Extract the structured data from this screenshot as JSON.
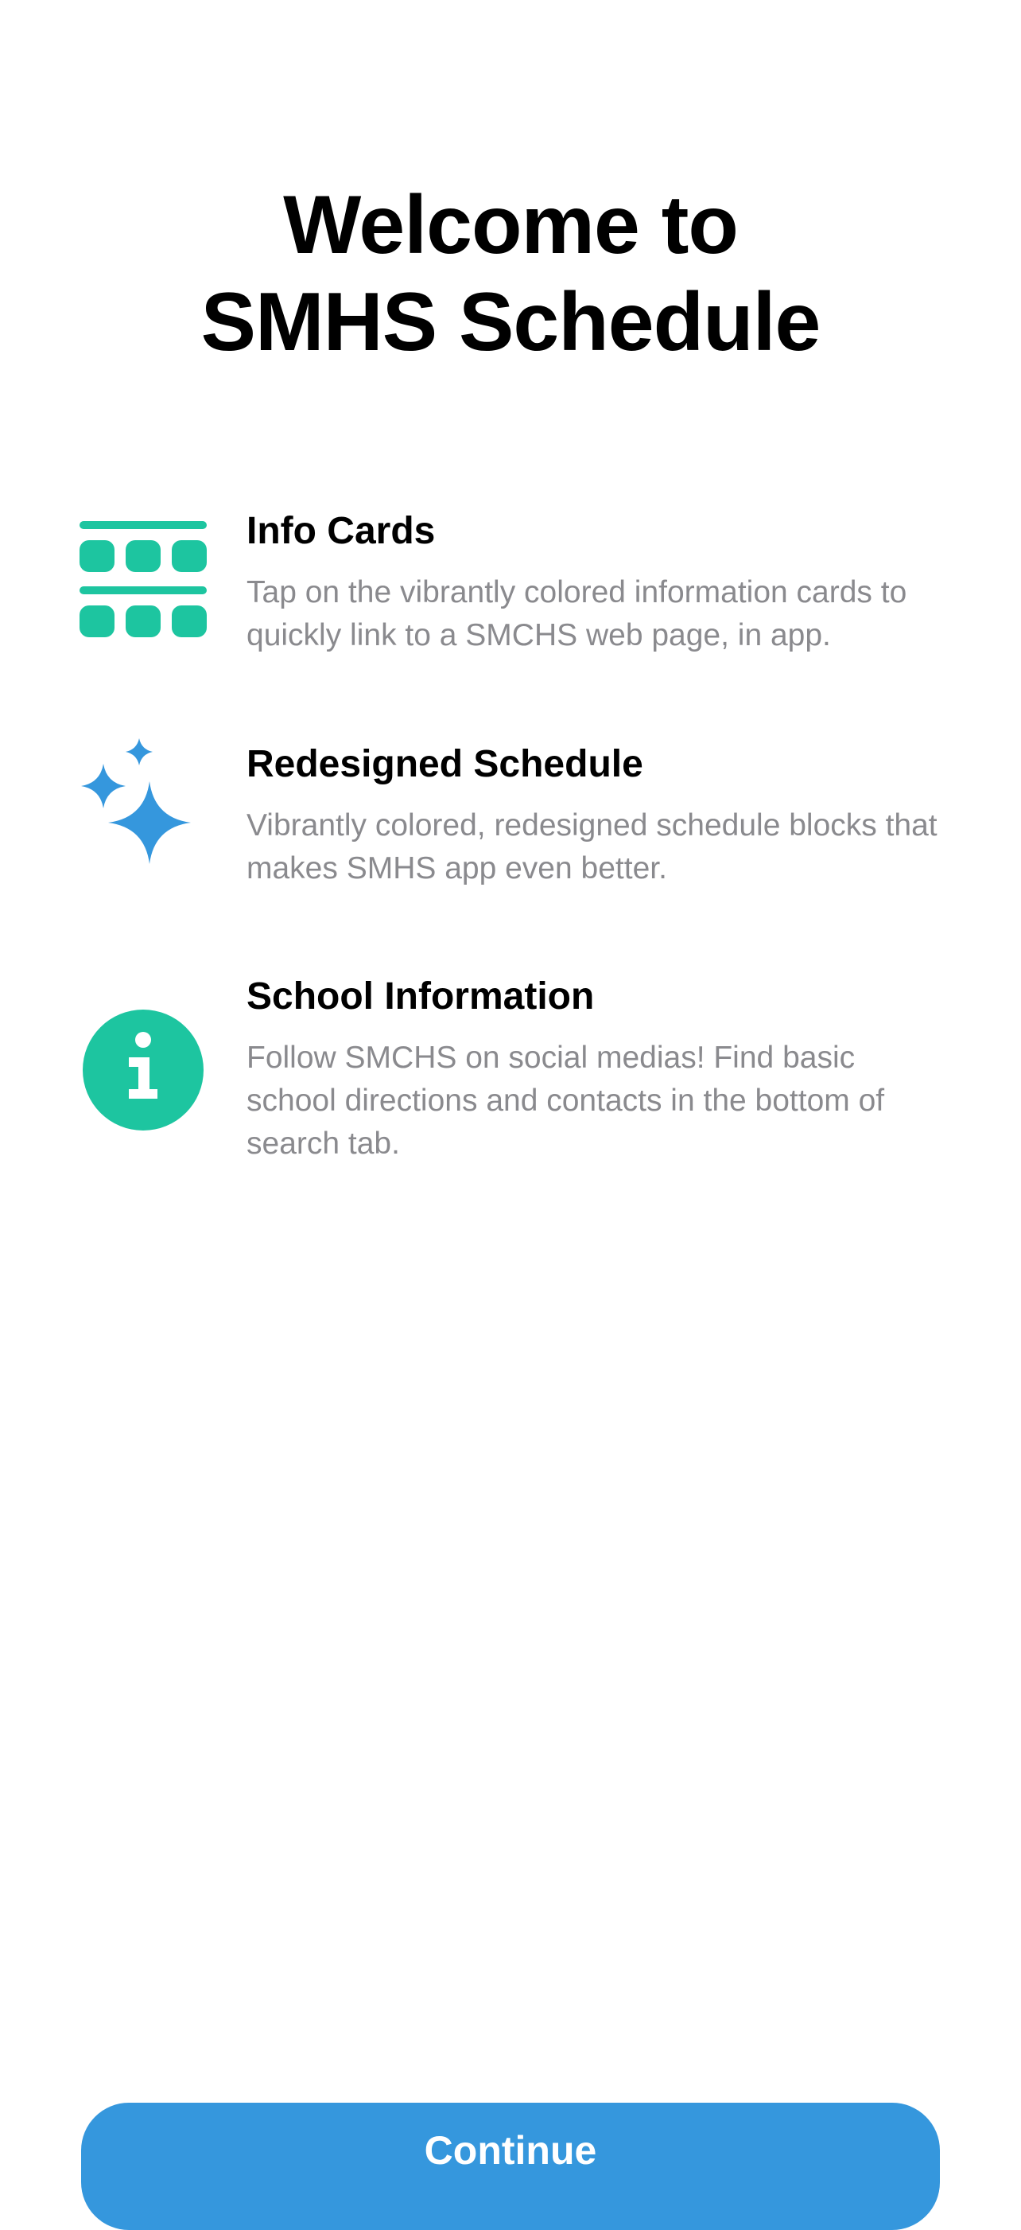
{
  "header": {
    "title_line1": "Welcome to",
    "title_line2": "SMHS Schedule"
  },
  "features": [
    {
      "icon": "grid-cards-icon",
      "title": "Info Cards",
      "description": "Tap on the vibrantly colored information cards to quickly link to a SMCHS web page, in app."
    },
    {
      "icon": "sparkles-icon",
      "title": "Redesigned Schedule",
      "description": "Vibrantly colored, redesigned schedule blocks that makes SMHS app even better."
    },
    {
      "icon": "info-circle-icon",
      "title": "School Information",
      "description": "Follow SMCHS on social medias! Find basic school directions and contacts in the bottom of search tab."
    }
  ],
  "footer": {
    "continue_label": "Continue"
  },
  "colors": {
    "teal_accent": "#1dc5a0",
    "blue_accent": "#3597dd",
    "secondary_text": "#8a8a8e"
  }
}
